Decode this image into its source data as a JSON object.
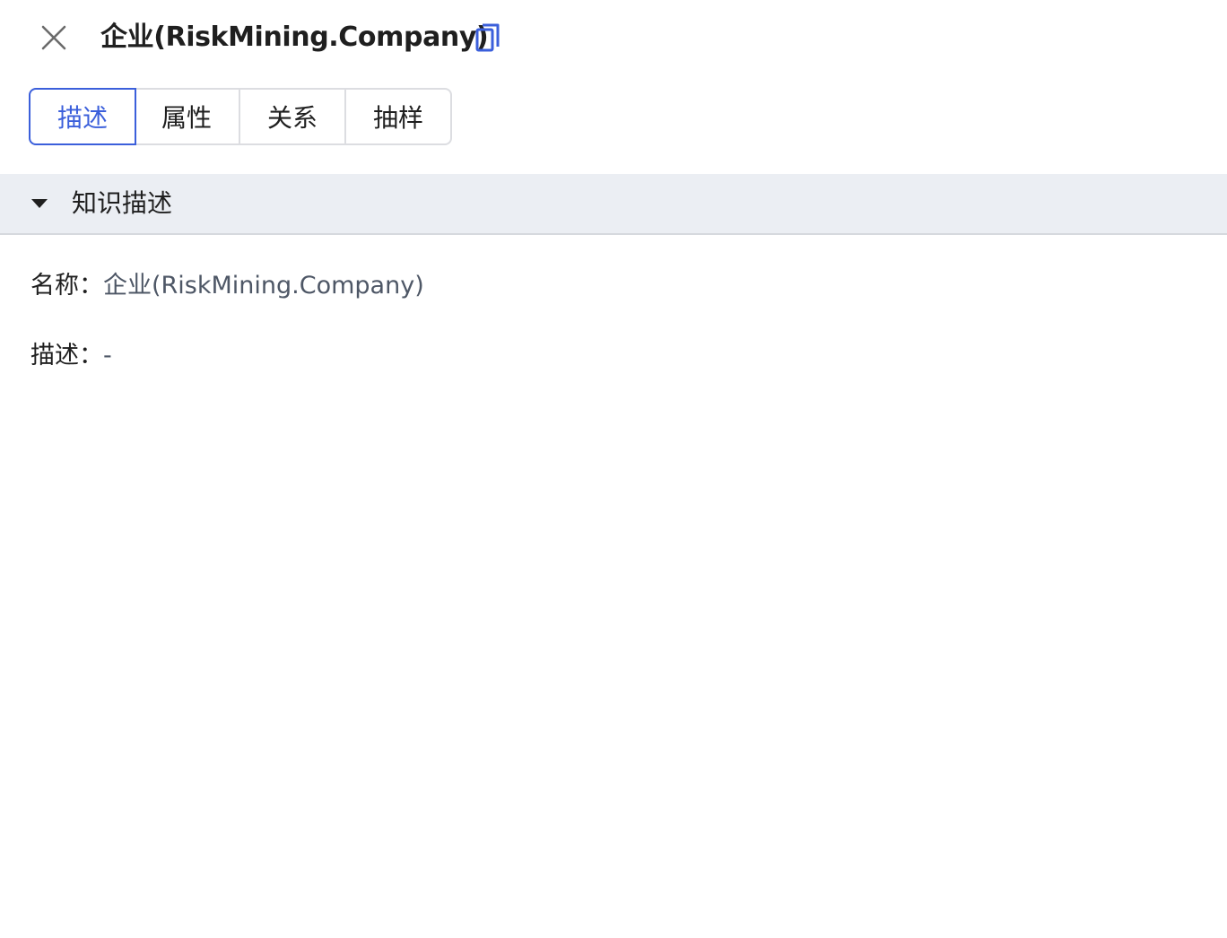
{
  "header": {
    "close_icon": "close-icon",
    "title": "企业(RiskMining.Company)",
    "copy_icon": "copy-icon",
    "accent_color": "#3b5fdb"
  },
  "tabs": [
    {
      "label": "描述",
      "active": true
    },
    {
      "label": "属性",
      "active": false
    },
    {
      "label": "关系",
      "active": false
    },
    {
      "label": "抽样",
      "active": false
    }
  ],
  "section": {
    "title": "知识描述",
    "expanded": true,
    "caret_icon": "caret-down-icon"
  },
  "fields": [
    {
      "label": "名称：",
      "value": "企业(RiskMining.Company)"
    },
    {
      "label": "描述：",
      "value": "-"
    }
  ]
}
